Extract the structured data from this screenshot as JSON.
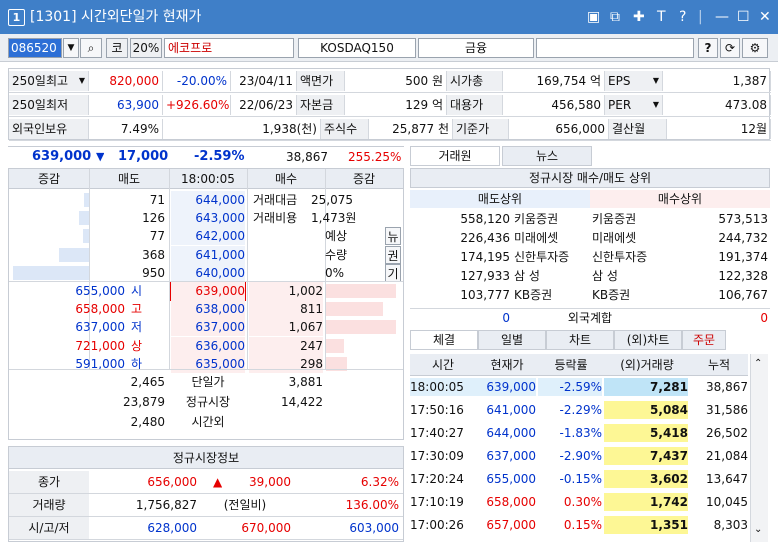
{
  "window": {
    "number": "1",
    "title": "[1301] 시간외단일가 현재가",
    "icons": [
      "dock-icon",
      "popout-icon",
      "pin-icon",
      "text-icon",
      "help-icon",
      "minimize-icon",
      "maximize-icon",
      "close-icon"
    ]
  },
  "toolbar": {
    "code": "086520",
    "badge": "코",
    "margin": "20%",
    "name": "에코프로",
    "index": "KOSDAQ150",
    "sector": "금융",
    "help": "?",
    "refresh": "⟳",
    "settings": "⚙"
  },
  "info": [
    [
      {
        "t": "250일최고",
        "k": "lbl",
        "dd": true
      },
      {
        "t": "820,000",
        "c": "red"
      },
      {
        "t": "-20.00%",
        "c": "blue"
      },
      {
        "t": "23/04/11"
      },
      {
        "t": "액면가",
        "k": "lbl"
      },
      {
        "t": "500 원"
      },
      {
        "t": "시가총",
        "k": "lbl"
      },
      {
        "t": "169,754 억"
      },
      {
        "t": "EPS",
        "k": "lbl",
        "dd": true
      },
      {
        "t": "1,387"
      }
    ],
    [
      {
        "t": "250일최저",
        "k": "lbl"
      },
      {
        "t": "63,900",
        "c": "blue"
      },
      {
        "t": "+926.60%",
        "c": "red"
      },
      {
        "t": "22/06/23"
      },
      {
        "t": "자본금",
        "k": "lbl"
      },
      {
        "t": "129 억"
      },
      {
        "t": "대용가",
        "k": "lbl"
      },
      {
        "t": "456,580"
      },
      {
        "t": "PER",
        "k": "lbl",
        "dd": true
      },
      {
        "t": "473.08"
      }
    ],
    [
      {
        "t": "외국인보유",
        "k": "lbl"
      },
      {
        "t": "7.49%"
      },
      {
        "t": "1,938(천)"
      },
      {
        "t": "주식수",
        "k": "lbl"
      },
      {
        "t": "25,877 천"
      },
      {
        "t": "기준가",
        "k": "lbl"
      },
      {
        "t": "656,000"
      },
      {
        "t": "결산월",
        "k": "lbl"
      },
      {
        "t": "12월"
      }
    ]
  ],
  "quote": {
    "price": "639,000",
    "arrow": "▼",
    "change": "17,000",
    "rate": "-2.59%",
    "volume": "38,867",
    "ratio": "255.25%"
  },
  "orderbook": {
    "headers": [
      "증감",
      "매도",
      "18:00:05",
      "매수",
      "증감"
    ],
    "asks": [
      {
        "qty": "71",
        "price": "644,000",
        "bar": 0.07
      },
      {
        "qty": "126",
        "price": "643,000",
        "bar": 0.13
      },
      {
        "qty": "77",
        "price": "642,000",
        "bar": 0.08
      },
      {
        "qty": "368",
        "price": "641,000",
        "bar": 0.39
      },
      {
        "qty": "950",
        "price": "640,000",
        "bar": 1.0
      }
    ],
    "bids": [
      {
        "qty": "1,002",
        "price": "639,000",
        "bar": 1.0
      },
      {
        "qty": "811",
        "price": "638,000",
        "bar": 0.81
      },
      {
        "qty": "1,067",
        "price": "637,000",
        "bar": 1.0
      },
      {
        "qty": "247",
        "price": "636,000",
        "bar": 0.25
      },
      {
        "qty": "298",
        "price": "635,000",
        "bar": 0.3
      }
    ],
    "side_info": [
      {
        "l": "거래대금",
        "v": "25,075"
      },
      {
        "l": "거래비용",
        "v": "1,473원"
      }
    ],
    "expect": {
      "l1": "예상",
      "l2": "수량",
      "v": "0%"
    },
    "vbtns": [
      "뉴",
      "권",
      "기"
    ],
    "left_stats": [
      {
        "p": "655,000",
        "l": "시",
        "c": "blue"
      },
      {
        "p": "658,000",
        "l": "고",
        "c": "red"
      },
      {
        "p": "637,000",
        "l": "저",
        "c": "blue"
      },
      {
        "p": "721,000",
        "l": "상",
        "c": "red"
      },
      {
        "p": "591,000",
        "l": "하",
        "c": "blue"
      }
    ],
    "summary": [
      {
        "a": "2,465",
        "m": "단일가",
        "b": "3,881"
      },
      {
        "a": "23,879",
        "m": "정규시장",
        "b": "14,422"
      },
      {
        "a": "2,480",
        "m": "시간외",
        "b": ""
      }
    ]
  },
  "regular": {
    "title": "정규시장정보",
    "rows": [
      {
        "l": "종가",
        "v1": "656,000",
        "v2": "39,000",
        "v3": "6.32%"
      },
      {
        "l": "거래량",
        "v1": "1,756,827",
        "v2": "(전일비)",
        "v3": "136.00%"
      },
      {
        "l": "시/고/저",
        "v1": "628,000",
        "v2": "670,000",
        "v3": "603,000"
      }
    ]
  },
  "broker": {
    "tabs": [
      "거래원",
      "뉴스"
    ],
    "title": "정규시장 매수/매도 상위",
    "sell_hdr": "매도상위",
    "buy_hdr": "매수상위",
    "rows": [
      {
        "sq": "558,120",
        "sn": "키움증권",
        "bn": "키움증권",
        "bq": "573,513"
      },
      {
        "sq": "226,436",
        "sn": "미래에셋",
        "bn": "미래에셋",
        "bq": "244,732"
      },
      {
        "sq": "174,195",
        "sn": "신한투자증",
        "bn": "신한투자증",
        "bq": "191,374"
      },
      {
        "sq": "127,933",
        "sn": "삼 성",
        "bn": "삼 성",
        "bq": "122,328"
      },
      {
        "sq": "103,777",
        "sn": "KB증권",
        "bn": "KB증권",
        "bq": "106,767"
      }
    ],
    "foreign": {
      "l": "0",
      "m": "외국계합",
      "r": "0"
    }
  },
  "trades": {
    "tabs": [
      "체결",
      "일별",
      "차트",
      "(외)차트",
      "주문"
    ],
    "headers": [
      "시간",
      "현재가",
      "등락률",
      "(외)거래량",
      "누적"
    ],
    "rows": [
      {
        "t": "18:00:05",
        "p": "639,000",
        "r": "-2.59%",
        "v": "7,281",
        "c": "38,867",
        "dir": "down",
        "hl": true
      },
      {
        "t": "17:50:16",
        "p": "641,000",
        "r": "-2.29%",
        "v": "5,084",
        "c": "31,586",
        "dir": "down"
      },
      {
        "t": "17:40:27",
        "p": "644,000",
        "r": "-1.83%",
        "v": "5,418",
        "c": "26,502",
        "dir": "down"
      },
      {
        "t": "17:30:09",
        "p": "637,000",
        "r": "-2.90%",
        "v": "7,437",
        "c": "21,084",
        "dir": "down"
      },
      {
        "t": "17:20:24",
        "p": "655,000",
        "r": "-0.15%",
        "v": "3,602",
        "c": "13,647",
        "dir": "down"
      },
      {
        "t": "17:10:19",
        "p": "658,000",
        "r": "0.30%",
        "v": "1,742",
        "c": "10,045",
        "dir": "up"
      },
      {
        "t": "17:00:26",
        "p": "657,000",
        "r": "0.15%",
        "v": "1,351",
        "c": "8,303",
        "dir": "up"
      }
    ]
  }
}
